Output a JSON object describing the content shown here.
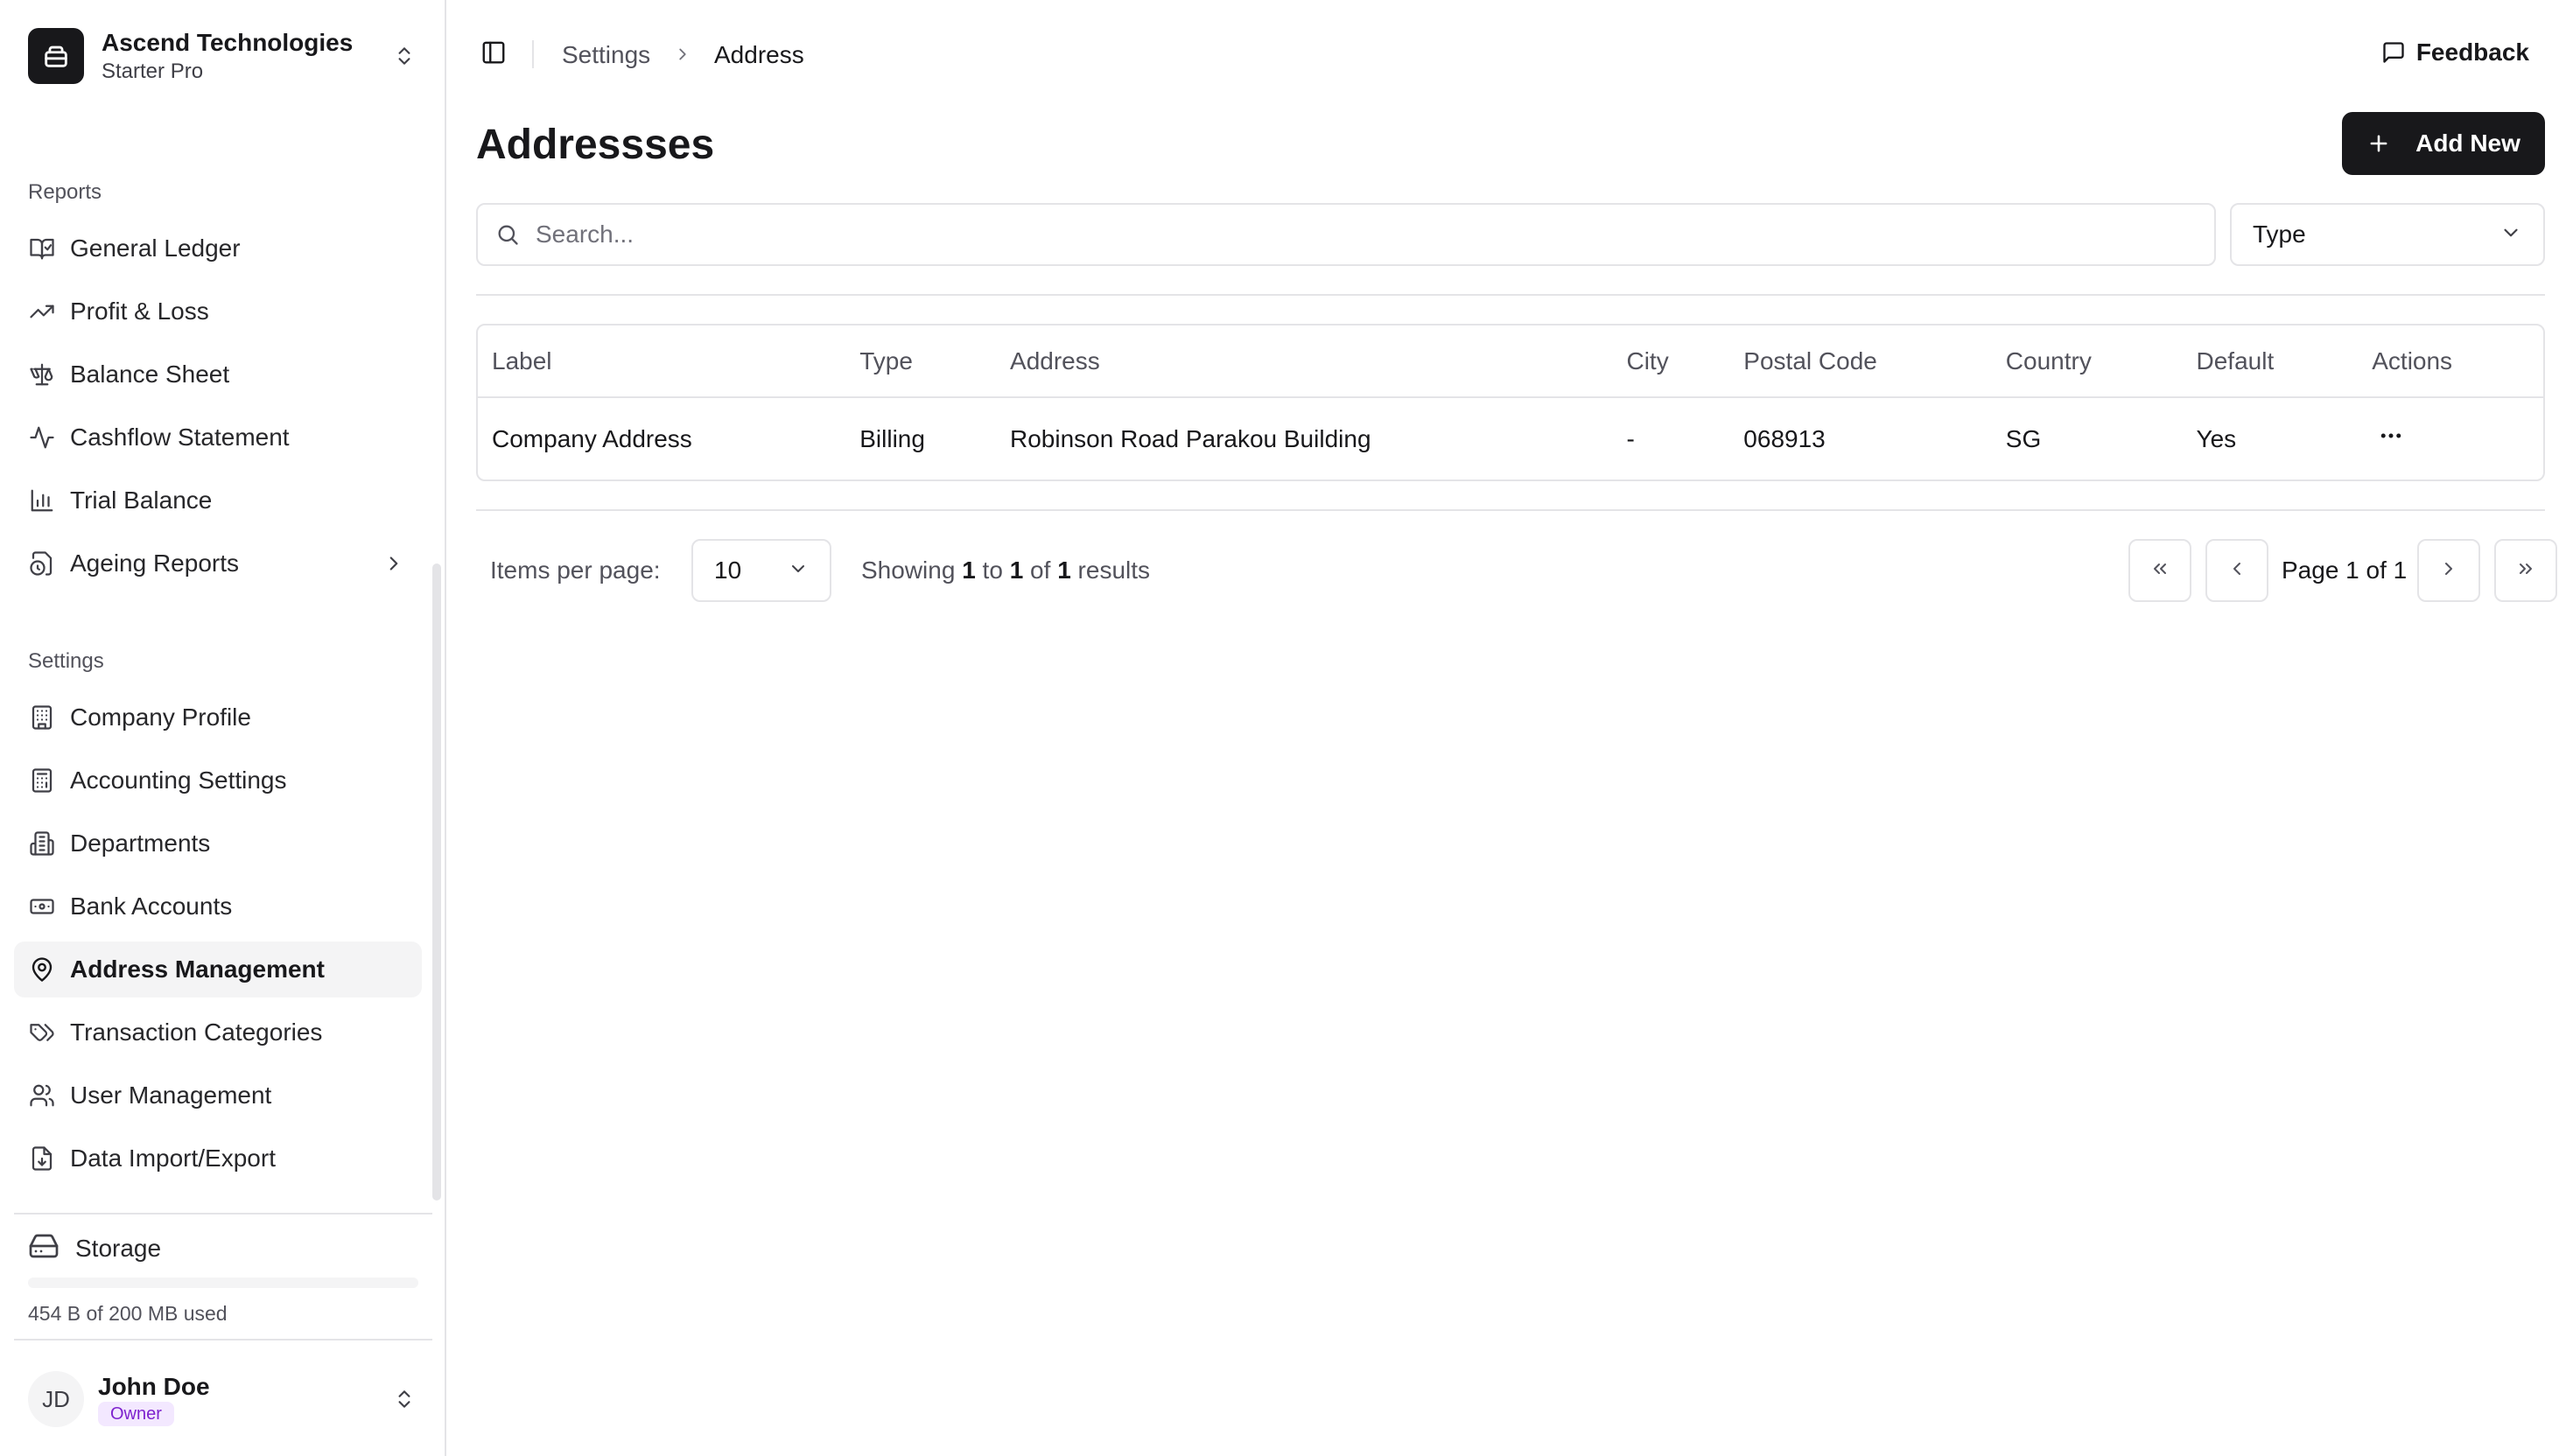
{
  "org": {
    "name": "Ascend Technologies",
    "plan": "Starter Pro"
  },
  "sidebar": {
    "reports_label": "Reports",
    "reports": [
      {
        "label": "General Ledger",
        "icon": "book-check-icon"
      },
      {
        "label": "Profit & Loss",
        "icon": "trending-up-icon"
      },
      {
        "label": "Balance Sheet",
        "icon": "scale-icon"
      },
      {
        "label": "Cashflow Statement",
        "icon": "activity-icon"
      },
      {
        "label": "Trial Balance",
        "icon": "bar-chart-icon"
      },
      {
        "label": "Ageing Reports",
        "icon": "file-clock-icon"
      }
    ],
    "settings_label": "Settings",
    "settings": [
      {
        "label": "Company Profile",
        "icon": "building-icon"
      },
      {
        "label": "Accounting Settings",
        "icon": "calculator-icon"
      },
      {
        "label": "Departments",
        "icon": "building-2-icon"
      },
      {
        "label": "Bank Accounts",
        "icon": "banknote-icon"
      },
      {
        "label": "Address Management",
        "icon": "map-pin-icon"
      },
      {
        "label": "Transaction Categories",
        "icon": "tags-icon"
      },
      {
        "label": "User Management",
        "icon": "users-icon"
      },
      {
        "label": "Data Import/Export",
        "icon": "file-import-icon"
      }
    ],
    "active_item": "Address Management"
  },
  "storage": {
    "label": "Storage",
    "usage_text": "454 B of 200 MB used",
    "used_fraction": 2e-06
  },
  "user": {
    "name": "John Doe",
    "initials": "JD",
    "role": "Owner"
  },
  "header": {
    "breadcrumb": [
      "Settings",
      "Address"
    ],
    "feedback_label": "Feedback"
  },
  "page": {
    "title": "Addressses",
    "add_button_label": "Add New",
    "search_placeholder": "Search...",
    "type_filter_label": "Type"
  },
  "table": {
    "columns": [
      "Label",
      "Type",
      "Address",
      "City",
      "Postal Code",
      "Country",
      "Default",
      "Actions"
    ],
    "rows": [
      {
        "label": "Company Address",
        "type": "Billing",
        "address": "Robinson Road Parakou Building",
        "city": "-",
        "postal_code": "068913",
        "country": "SG",
        "default": "Yes"
      }
    ]
  },
  "pagination": {
    "items_per_page_label": "Items per page:",
    "items_per_page": "10",
    "showing_prefix": "Showing",
    "from": "1",
    "to_word": "to",
    "to": "1",
    "of_word": "of",
    "total": "1",
    "results_word": "results",
    "page_info": "Page 1 of 1"
  },
  "colors": {
    "primary": "#18181b",
    "border": "#e4e4e7",
    "muted_text": "#52525b",
    "active_bg": "#f4f4f5",
    "badge_text": "#7e22ce",
    "badge_bg": "#f3e8ff"
  }
}
